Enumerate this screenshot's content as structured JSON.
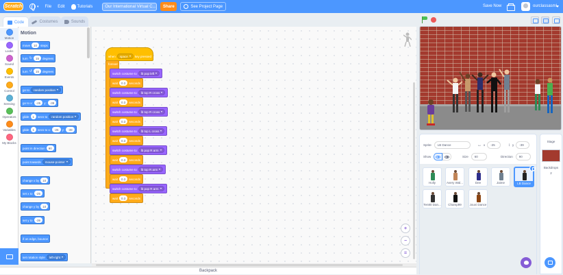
{
  "menu": {
    "logo": "Scratch",
    "file": "File",
    "edit": "Edit",
    "tutorials": "Tutorials",
    "project_title": "Our International Virtual C...",
    "share": "Share",
    "see_project_page": "See Project Page",
    "save_now": "Save Now",
    "username": "ourclassasml"
  },
  "tabs": {
    "code": "Code",
    "costumes": "Costumes",
    "sounds": "Sounds"
  },
  "categories": [
    {
      "label": "Motion",
      "color": "#4c97ff"
    },
    {
      "label": "Looks",
      "color": "#9966ff"
    },
    {
      "label": "Sound",
      "color": "#cf63cf"
    },
    {
      "label": "Events",
      "color": "#ffbf00"
    },
    {
      "label": "Control",
      "color": "#ffab19"
    },
    {
      "label": "Sensing",
      "color": "#5cb1d6"
    },
    {
      "label": "Operators",
      "color": "#59c059"
    },
    {
      "label": "Variables",
      "color": "#ff8c1a"
    },
    {
      "label": "My Blocks",
      "color": "#ff6680"
    }
  ],
  "palette": {
    "title": "Motion",
    "move": {
      "a": "move",
      "v": "10",
      "b": "steps"
    },
    "turn_right": {
      "a": "turn",
      "v": "15",
      "b": "degrees"
    },
    "turn_left": {
      "a": "turn",
      "v": "15",
      "b": "degrees"
    },
    "goto": {
      "a": "go to",
      "dd": "random position"
    },
    "goto_xy": {
      "a": "go to x:",
      "x": "-25",
      "b": "y:",
      "y": "-39"
    },
    "glide_to": {
      "a": "glide",
      "v": "1",
      "b": "secs to",
      "dd": "random position"
    },
    "glide_xy": {
      "a": "glide",
      "v": "1",
      "b": "secs to x:",
      "x": "-25",
      "c": "y:",
      "y": "-39"
    },
    "point_dir": {
      "a": "point in direction",
      "v": "90"
    },
    "point_towards": {
      "a": "point towards",
      "dd": "mouse-pointer"
    },
    "change_x": {
      "a": "change x by",
      "v": "10"
    },
    "set_x": {
      "a": "set x to",
      "v": "-25"
    },
    "change_y": {
      "a": "change y by",
      "v": "10"
    },
    "set_y": {
      "a": "set y to",
      "v": "-39"
    },
    "bounce": {
      "a": "if on edge, bounce"
    },
    "rotation": {
      "a": "set rotation style",
      "dd": "left-right"
    }
  },
  "script": {
    "hat": {
      "a": "when",
      "key": "space",
      "b": "key pressed"
    },
    "forever": "forever",
    "blocks": [
      {
        "type": "looks",
        "a": "switch costume to",
        "dd": "lb pop left"
      },
      {
        "type": "control",
        "a": "wait",
        "v": "0.3",
        "b": "seconds"
      },
      {
        "type": "looks",
        "a": "switch costume to",
        "dd": "lb top R cross"
      },
      {
        "type": "control",
        "a": "wait",
        "v": "0.3",
        "b": "seconds"
      },
      {
        "type": "looks",
        "a": "switch costume to",
        "dd": "lb top R cross"
      },
      {
        "type": "control",
        "a": "wait",
        "v": "0.3",
        "b": "seconds"
      },
      {
        "type": "looks",
        "a": "switch costume to",
        "dd": "lb top L cross"
      },
      {
        "type": "control",
        "a": "wait",
        "v": "0.3",
        "b": "seconds"
      },
      {
        "type": "looks",
        "a": "switch costume to",
        "dd": "lb pop R arm"
      },
      {
        "type": "control",
        "a": "wait",
        "v": "0.3",
        "b": "seconds"
      },
      {
        "type": "looks",
        "a": "switch costume to",
        "dd": "lb top R arm"
      },
      {
        "type": "control",
        "a": "wait",
        "v": "0.3",
        "b": "seconds"
      },
      {
        "type": "looks",
        "a": "switch costume to",
        "dd": "lb pop R arm"
      },
      {
        "type": "control",
        "a": "wait",
        "v": "0.3",
        "b": "seconds"
      }
    ]
  },
  "zoom": {
    "in": "+",
    "out": "−",
    "reset": "="
  },
  "backpack": "Backpack",
  "sprite_info": {
    "sprite_label": "Sprite",
    "sprite_name": "LB Dance",
    "x_label": "x",
    "x": "-25",
    "y_label": "y",
    "y": "-39",
    "show_label": "Show",
    "size_label": "Size",
    "size": "60",
    "direction_label": "Direction",
    "direction": "90"
  },
  "sprites": [
    {
      "name": "Holly",
      "color": "#2e8b57"
    },
    {
      "name": "Avery Wal...",
      "color": "#c08457"
    },
    {
      "name": "Dee",
      "color": "#2e2e8a"
    },
    {
      "name": "Jaime",
      "color": "#708090"
    },
    {
      "name": "LB Dance",
      "color": "#222222"
    },
    {
      "name": "Ten80 Dan...",
      "color": "#333333"
    },
    {
      "name": "Champ99",
      "color": "#111111"
    },
    {
      "name": "Jouvi Dance",
      "color": "#8b4513"
    }
  ],
  "stage_panel": {
    "title": "Stage",
    "backdrops_label": "Backdrops",
    "backdrops_count": "2"
  }
}
